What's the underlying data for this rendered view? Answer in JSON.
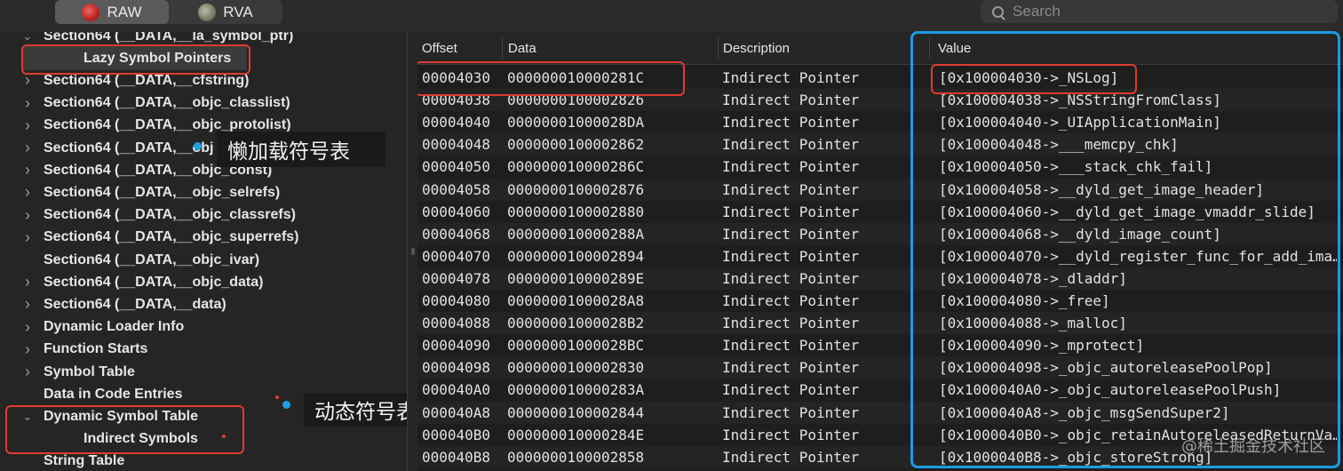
{
  "toolbar": {
    "raw_label": "RAW",
    "rva_label": "RVA",
    "search_placeholder": "Search"
  },
  "sidebar": {
    "items": [
      {
        "label": "Section64 (__DATA,__la_symbol_ptr)",
        "expand": "open"
      },
      {
        "label": "Lazy Symbol Pointers",
        "expand": "none"
      },
      {
        "label": "Section64 (__DATA,__cfstring)",
        "expand": "closed"
      },
      {
        "label": "Section64 (__DATA,__objc_classlist)",
        "expand": "closed"
      },
      {
        "label": "Section64 (__DATA,__objc_protolist)",
        "expand": "closed"
      },
      {
        "label": "Section64 (__DATA,__obj",
        "expand": "closed"
      },
      {
        "label": "Section64 (__DATA,__objc_const)",
        "expand": "closed"
      },
      {
        "label": "Section64 (__DATA,__objc_selrefs)",
        "expand": "closed"
      },
      {
        "label": "Section64 (__DATA,__objc_classrefs)",
        "expand": "closed"
      },
      {
        "label": "Section64 (__DATA,__objc_superrefs)",
        "expand": "closed"
      },
      {
        "label": "Section64 (__DATA,__objc_ivar)",
        "expand": "none"
      },
      {
        "label": "Section64 (__DATA,__objc_data)",
        "expand": "closed"
      },
      {
        "label": "Section64 (__DATA,__data)",
        "expand": "closed"
      },
      {
        "label": "Dynamic Loader Info",
        "expand": "closed"
      },
      {
        "label": "Function Starts",
        "expand": "closed"
      },
      {
        "label": "Symbol Table",
        "expand": "closed"
      },
      {
        "label": "Data in Code Entries",
        "expand": "none"
      },
      {
        "label": "Dynamic Symbol Table",
        "expand": "open"
      },
      {
        "label": "Indirect Symbols",
        "expand": "none"
      },
      {
        "label": "String Table",
        "expand": "none"
      }
    ]
  },
  "annotations": {
    "lazy_callout": "懒加载符号表",
    "dynamic_callout": "动态符号表",
    "highlight_color": "#e03a30",
    "value_box_color": "#1c9be3"
  },
  "table": {
    "columns": {
      "offset": "Offset",
      "data": "Data",
      "description": "Description",
      "value": "Value"
    },
    "rows": [
      {
        "offset": "00004030",
        "data": "000000010000281C",
        "description": "Indirect Pointer",
        "value": "[0x100004030->_NSLog]"
      },
      {
        "offset": "00004038",
        "data": "0000000100002826",
        "description": "Indirect Pointer",
        "value": "[0x100004038->_NSStringFromClass]"
      },
      {
        "offset": "00004040",
        "data": "00000001000028DA",
        "description": "Indirect Pointer",
        "value": "[0x100004040->_UIApplicationMain]"
      },
      {
        "offset": "00004048",
        "data": "0000000100002862",
        "description": "Indirect Pointer",
        "value": "[0x100004048->___memcpy_chk]"
      },
      {
        "offset": "00004050",
        "data": "000000010000286C",
        "description": "Indirect Pointer",
        "value": "[0x100004050->___stack_chk_fail]"
      },
      {
        "offset": "00004058",
        "data": "0000000100002876",
        "description": "Indirect Pointer",
        "value": "[0x100004058->__dyld_get_image_header]"
      },
      {
        "offset": "00004060",
        "data": "0000000100002880",
        "description": "Indirect Pointer",
        "value": "[0x100004060->__dyld_get_image_vmaddr_slide]"
      },
      {
        "offset": "00004068",
        "data": "000000010000288A",
        "description": "Indirect Pointer",
        "value": "[0x100004068->__dyld_image_count]"
      },
      {
        "offset": "00004070",
        "data": "0000000100002894",
        "description": "Indirect Pointer",
        "value": "[0x100004070->__dyld_register_func_for_add_ima…"
      },
      {
        "offset": "00004078",
        "data": "000000010000289E",
        "description": "Indirect Pointer",
        "value": "[0x100004078->_dladdr]"
      },
      {
        "offset": "00004080",
        "data": "00000001000028A8",
        "description": "Indirect Pointer",
        "value": "[0x100004080->_free]"
      },
      {
        "offset": "00004088",
        "data": "00000001000028B2",
        "description": "Indirect Pointer",
        "value": "[0x100004088->_malloc]"
      },
      {
        "offset": "00004090",
        "data": "00000001000028BC",
        "description": "Indirect Pointer",
        "value": "[0x100004090->_mprotect]"
      },
      {
        "offset": "00004098",
        "data": "0000000100002830",
        "description": "Indirect Pointer",
        "value": "[0x100004098->_objc_autoreleasePoolPop]"
      },
      {
        "offset": "000040A0",
        "data": "000000010000283A",
        "description": "Indirect Pointer",
        "value": "[0x1000040A0->_objc_autoreleasePoolPush]"
      },
      {
        "offset": "000040A8",
        "data": "0000000100002844",
        "description": "Indirect Pointer",
        "value": "[0x1000040A8->_objc_msgSendSuper2]"
      },
      {
        "offset": "000040B0",
        "data": "000000010000284E",
        "description": "Indirect Pointer",
        "value": "[0x1000040B0->_objc_retainAutoreleasedReturnVa…"
      },
      {
        "offset": "000040B8",
        "data": "0000000100002858",
        "description": "Indirect Pointer",
        "value": "[0x1000040B8->_objc_storeStrong]"
      }
    ]
  },
  "watermark": "@稀土掘金技术社区"
}
